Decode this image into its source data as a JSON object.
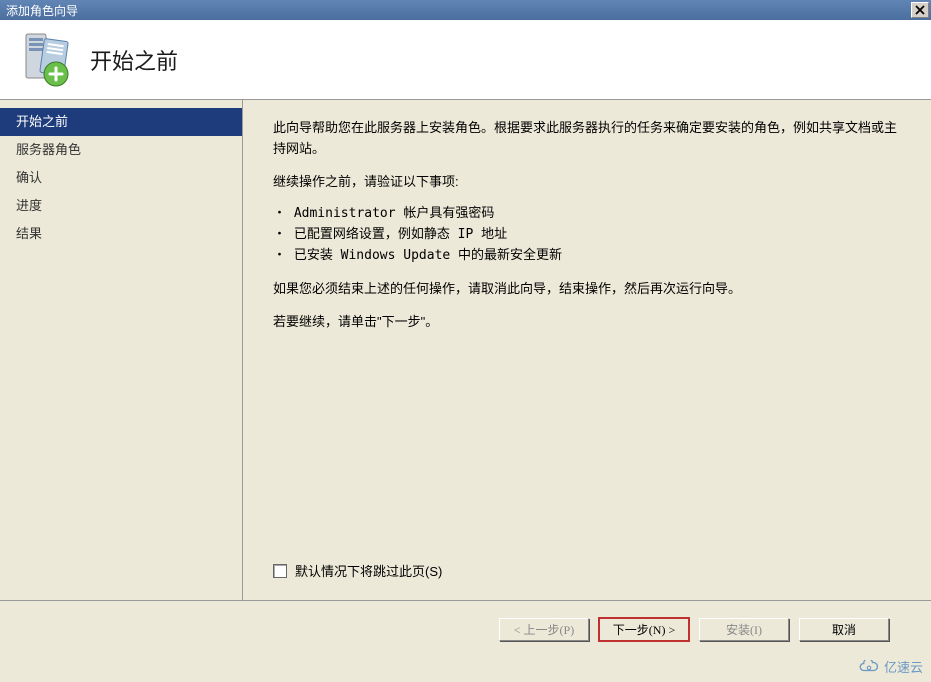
{
  "window": {
    "title": "添加角色向导"
  },
  "header": {
    "title": "开始之前"
  },
  "sidebar": {
    "items": [
      {
        "label": "开始之前",
        "active": true
      },
      {
        "label": "服务器角色",
        "active": false
      },
      {
        "label": "确认",
        "active": false
      },
      {
        "label": "进度",
        "active": false
      },
      {
        "label": "结果",
        "active": false
      }
    ]
  },
  "content": {
    "intro": "此向导帮助您在此服务器上安装角色。根据要求此服务器执行的任务来确定要安装的角色，例如共享文档或主持网站。",
    "verify_prompt": "继续操作之前，请验证以下事项:",
    "bullets": [
      "Administrator 帐户具有强密码",
      "已配置网络设置，例如静态 IP 地址",
      "已安装 Windows Update 中的最新安全更新"
    ],
    "cancel_note": "如果您必须结束上述的任何操作，请取消此向导，结束操作，然后再次运行向导。",
    "continue_note": "若要继续，请单击\"下一步\"。",
    "skip_checkbox_label": "默认情况下将跳过此页(S)"
  },
  "footer": {
    "prev": "< 上一步(P)",
    "next": "下一步(N) >",
    "install": "安装(I)",
    "cancel": "取消"
  },
  "watermark": {
    "text": "亿速云"
  }
}
